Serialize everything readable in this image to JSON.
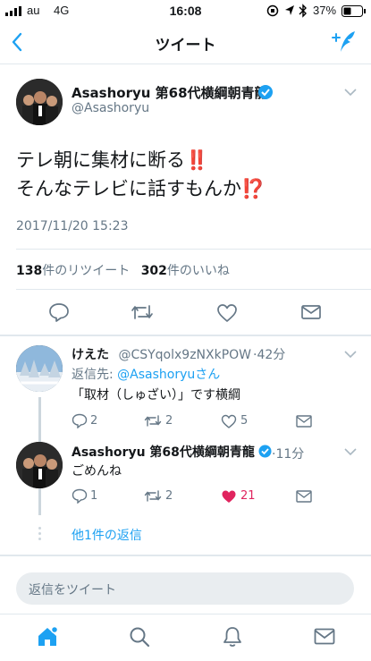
{
  "status_bar": {
    "carrier": "au",
    "network": "4G",
    "time": "16:08",
    "battery": "37%"
  },
  "nav": {
    "title": "ツイート"
  },
  "tweet": {
    "display_name": "Asashoryu 第68代横綱朝青龍",
    "handle": "@Asashoryu",
    "text_line1": "テレ朝に集材に断る‼️",
    "text_line2": "そんなテレビに話すもんか⁉️",
    "timestamp": "2017/11/20 15:23",
    "retweet_count": "138",
    "retweet_label": "件のリツイート",
    "like_count": "302",
    "like_label": "件のいいね"
  },
  "replies": [
    {
      "display_name": "けえた",
      "handle": "@CSYqolx9zNXkPOW",
      "time": "42分",
      "reply_to_prefix": "返信先: ",
      "reply_to_handle": "@Asashoryuさん",
      "text": "「取材（しゅざい）」です横綱",
      "reply_count": "2",
      "retweet_count": "2",
      "like_count": "5"
    },
    {
      "display_name": "Asashoryu 第68代横綱朝青龍",
      "handle": "",
      "time": "11分",
      "text": "ごめんね",
      "reply_count": "1",
      "retweet_count": "2",
      "like_count": "21"
    }
  ],
  "more_replies": "他1件の返信",
  "compose": {
    "placeholder": "返信をツイート"
  },
  "colors": {
    "accent": "#1da1f2",
    "like": "#e0245e",
    "verified": "#1da1f2",
    "emoji_red": "#e0245e"
  }
}
